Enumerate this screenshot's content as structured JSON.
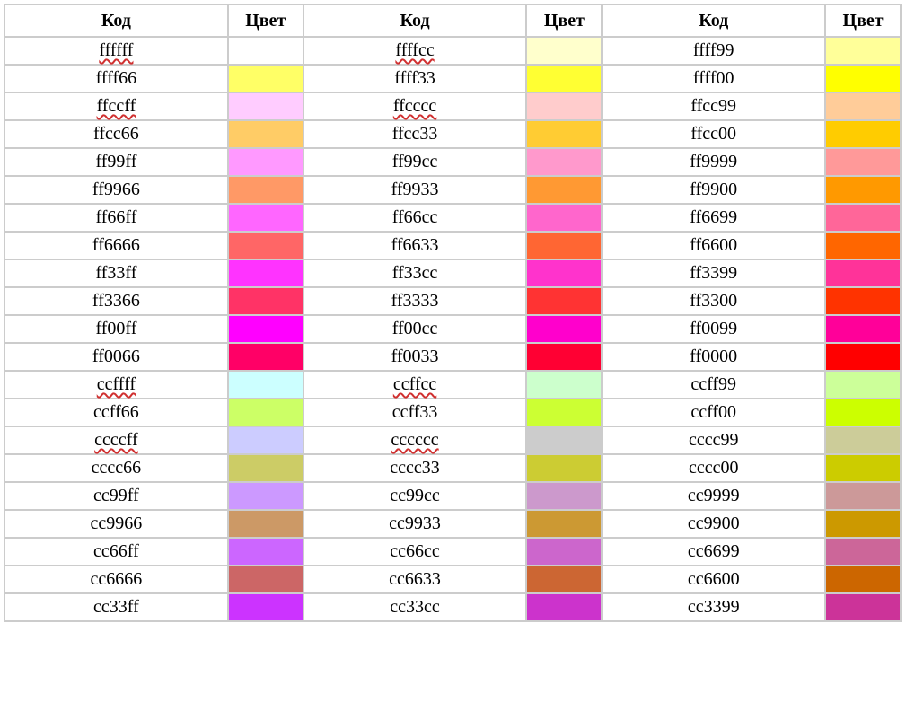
{
  "headers": {
    "code": "Код",
    "color": "Цвет"
  },
  "chart_data": {
    "type": "table",
    "title": "",
    "columns": [
      "Код",
      "Цвет",
      "Код",
      "Цвет",
      "Код",
      "Цвет"
    ],
    "rows": [
      [
        {
          "code": "ffffff",
          "underlined": true
        },
        {
          "code": "ffffcc",
          "underlined": true
        },
        {
          "code": "ffff99",
          "underlined": false
        }
      ],
      [
        {
          "code": "ffff66",
          "underlined": false
        },
        {
          "code": "ffff33",
          "underlined": false
        },
        {
          "code": "ffff00",
          "underlined": false
        }
      ],
      [
        {
          "code": "ffccff",
          "underlined": true
        },
        {
          "code": "ffcccc",
          "underlined": true
        },
        {
          "code": "ffcc99",
          "underlined": false
        }
      ],
      [
        {
          "code": "ffcc66",
          "underlined": false
        },
        {
          "code": "ffcc33",
          "underlined": false
        },
        {
          "code": "ffcc00",
          "underlined": false
        }
      ],
      [
        {
          "code": "ff99ff",
          "underlined": false
        },
        {
          "code": "ff99cc",
          "underlined": false
        },
        {
          "code": "ff9999",
          "underlined": false
        }
      ],
      [
        {
          "code": "ff9966",
          "underlined": false
        },
        {
          "code": "ff9933",
          "underlined": false
        },
        {
          "code": "ff9900",
          "underlined": false
        }
      ],
      [
        {
          "code": "ff66ff",
          "underlined": false
        },
        {
          "code": "ff66cc",
          "underlined": false
        },
        {
          "code": "ff6699",
          "underlined": false
        }
      ],
      [
        {
          "code": "ff6666",
          "underlined": false
        },
        {
          "code": "ff6633",
          "underlined": false
        },
        {
          "code": "ff6600",
          "underlined": false
        }
      ],
      [
        {
          "code": "ff33ff",
          "underlined": false
        },
        {
          "code": "ff33cc",
          "underlined": false
        },
        {
          "code": "ff3399",
          "underlined": false
        }
      ],
      [
        {
          "code": "ff3366",
          "underlined": false
        },
        {
          "code": "ff3333",
          "underlined": false
        },
        {
          "code": "ff3300",
          "underlined": false
        }
      ],
      [
        {
          "code": "ff00ff",
          "underlined": false
        },
        {
          "code": "ff00cc",
          "underlined": false
        },
        {
          "code": "ff0099",
          "underlined": false
        }
      ],
      [
        {
          "code": "ff0066",
          "underlined": false
        },
        {
          "code": "ff0033",
          "underlined": false
        },
        {
          "code": "ff0000",
          "underlined": false
        }
      ],
      [
        {
          "code": "ccffff",
          "underlined": true
        },
        {
          "code": "ccffcc",
          "underlined": true
        },
        {
          "code": "ccff99",
          "underlined": false
        }
      ],
      [
        {
          "code": "ccff66",
          "underlined": false
        },
        {
          "code": "ccff33",
          "underlined": false
        },
        {
          "code": "ccff00",
          "underlined": false
        }
      ],
      [
        {
          "code": "ccccff",
          "underlined": true
        },
        {
          "code": "cccccc",
          "underlined": true
        },
        {
          "code": "cccc99",
          "underlined": false
        }
      ],
      [
        {
          "code": "cccc66",
          "underlined": false
        },
        {
          "code": "cccc33",
          "underlined": false
        },
        {
          "code": "cccc00",
          "underlined": false
        }
      ],
      [
        {
          "code": "cc99ff",
          "underlined": false
        },
        {
          "code": "cc99cc",
          "underlined": false
        },
        {
          "code": "cc9999",
          "underlined": false
        }
      ],
      [
        {
          "code": "cc9966",
          "underlined": false
        },
        {
          "code": "cc9933",
          "underlined": false
        },
        {
          "code": "cc9900",
          "underlined": false
        }
      ],
      [
        {
          "code": "cc66ff",
          "underlined": false
        },
        {
          "code": "cc66cc",
          "underlined": false
        },
        {
          "code": "cc6699",
          "underlined": false
        }
      ],
      [
        {
          "code": "cc6666",
          "underlined": false
        },
        {
          "code": "cc6633",
          "underlined": false
        },
        {
          "code": "cc6600",
          "underlined": false
        }
      ],
      [
        {
          "code": "cc33ff",
          "underlined": false
        },
        {
          "code": "cc33cc",
          "underlined": false
        },
        {
          "code": "cc3399",
          "underlined": false
        }
      ]
    ]
  }
}
